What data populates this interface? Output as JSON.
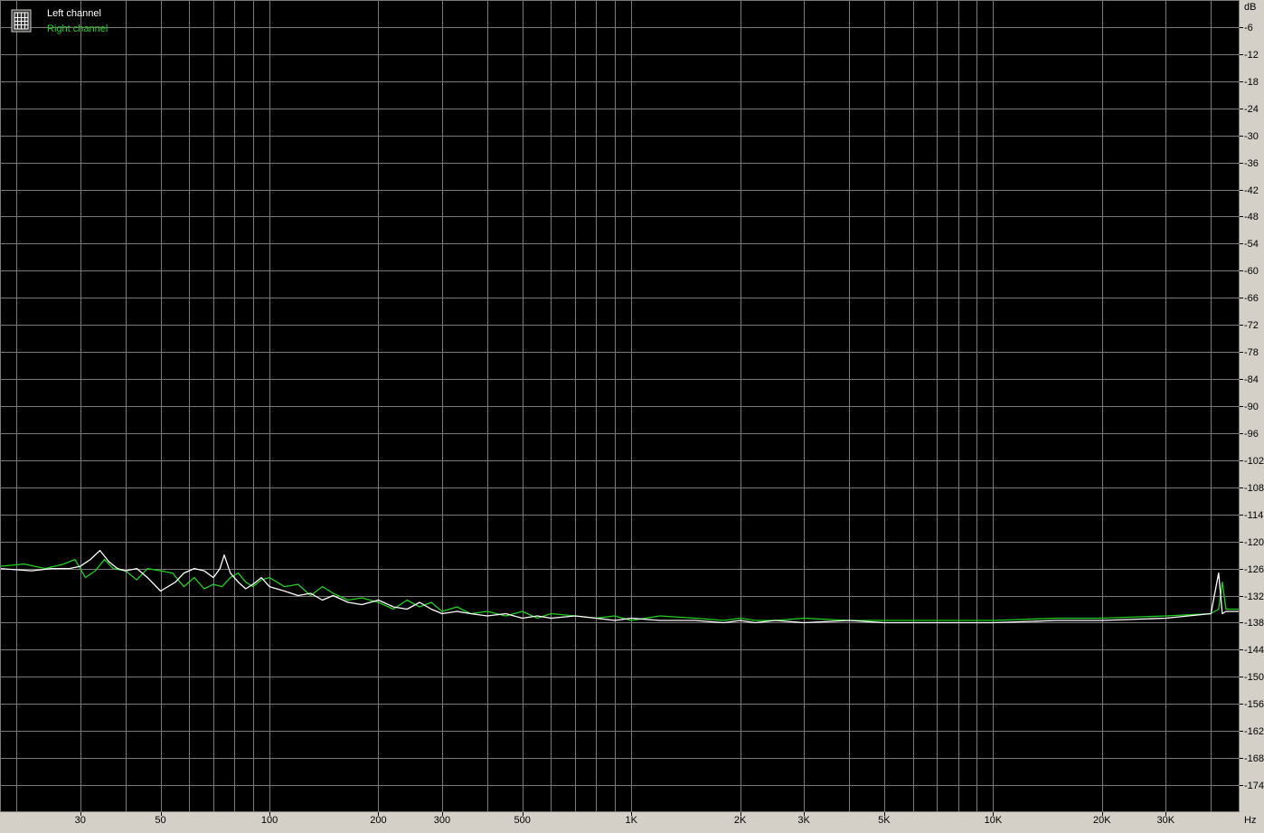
{
  "chart_data": {
    "type": "line",
    "title": "",
    "xlabel": "",
    "ylabel": "",
    "x_scale": "log",
    "x_unit": "Hz",
    "y_unit": "dB",
    "xlim": [
      18,
      48000
    ],
    "ylim": [
      -180,
      0
    ],
    "grid": true,
    "legend_position": "top-left",
    "legend_icon": "grid-chart-icon",
    "x_ticks": [
      {
        "value": 30,
        "label": "30"
      },
      {
        "value": 50,
        "label": "50"
      },
      {
        "value": 100,
        "label": "100"
      },
      {
        "value": 200,
        "label": "200"
      },
      {
        "value": 300,
        "label": "300"
      },
      {
        "value": 500,
        "label": "500"
      },
      {
        "value": 1000,
        "label": "1K"
      },
      {
        "value": 2000,
        "label": "2K"
      },
      {
        "value": 3000,
        "label": "3K"
      },
      {
        "value": 5000,
        "label": "5K"
      },
      {
        "value": 10000,
        "label": "10K"
      },
      {
        "value": 20000,
        "label": "20K"
      },
      {
        "value": 30000,
        "label": "30K"
      }
    ],
    "x_minor_grid": [
      20,
      40,
      60,
      70,
      80,
      90,
      400,
      600,
      700,
      800,
      900,
      4000,
      6000,
      7000,
      8000,
      9000,
      40000
    ],
    "y_ticks": [
      -6,
      -12,
      -18,
      -24,
      -30,
      -36,
      -42,
      -48,
      -54,
      -60,
      -66,
      -72,
      -78,
      -84,
      -90,
      -96,
      -102,
      -108,
      -114,
      -120,
      -126,
      -132,
      -138,
      -144,
      -150,
      -156,
      -162,
      -168,
      -174
    ],
    "colors": {
      "background": "#000000",
      "grid": "#7a7a7a",
      "frame": "#d4d0c8",
      "left": "#ffffff",
      "right": "#1fd11f",
      "text": "#000000"
    },
    "series": [
      {
        "name": "Left channel",
        "color": "#ffffff",
        "x": [
          18,
          22,
          25,
          28,
          30,
          32,
          34,
          36,
          38,
          40,
          43,
          46,
          50,
          55,
          58,
          62,
          66,
          70,
          73,
          75,
          78,
          82,
          86,
          90,
          95,
          100,
          110,
          120,
          130,
          140,
          150,
          165,
          180,
          200,
          220,
          240,
          260,
          280,
          300,
          330,
          360,
          400,
          450,
          500,
          550,
          600,
          700,
          800,
          900,
          1000,
          1200,
          1500,
          1800,
          2000,
          2200,
          2500,
          3000,
          4000,
          5000,
          7000,
          10000,
          15000,
          20000,
          30000,
          40000,
          42000,
          43000,
          44000,
          48000
        ],
        "y": [
          -126,
          -126.5,
          -126,
          -126,
          -125.5,
          -124,
          -122,
          -124.5,
          -126,
          -126.5,
          -126,
          -128,
          -131,
          -129,
          -127,
          -126,
          -126.5,
          -128,
          -126,
          -123,
          -127,
          -129,
          -130.5,
          -129.5,
          -128,
          -130,
          -131,
          -132,
          -131.5,
          -133,
          -132,
          -133.5,
          -134,
          -133,
          -134.5,
          -135,
          -133.5,
          -135,
          -136,
          -135.5,
          -136,
          -136.5,
          -136,
          -137,
          -136.5,
          -137,
          -136.5,
          -137,
          -137.5,
          -137,
          -137.5,
          -137.5,
          -138,
          -137.5,
          -138,
          -137.5,
          -138,
          -137.5,
          -138,
          -138,
          -138,
          -137.5,
          -137.5,
          -137,
          -136,
          -127,
          -136,
          -135.5,
          -135.5
        ]
      },
      {
        "name": "Right channel",
        "color": "#1fd11f",
        "x": [
          18,
          21,
          24,
          27,
          29,
          31,
          33,
          35,
          37,
          40,
          43,
          46,
          50,
          54,
          58,
          62,
          66,
          70,
          74,
          78,
          82,
          86,
          90,
          95,
          100,
          110,
          120,
          130,
          140,
          150,
          165,
          180,
          200,
          220,
          240,
          260,
          280,
          300,
          330,
          360,
          400,
          450,
          500,
          550,
          600,
          700,
          800,
          900,
          1000,
          1200,
          1500,
          1800,
          2000,
          2200,
          2500,
          3000,
          4000,
          5000,
          7000,
          10000,
          15000,
          20000,
          30000,
          40000,
          42000,
          43000,
          44000,
          48000
        ],
        "y": [
          -125.5,
          -125,
          -126,
          -125,
          -124,
          -128,
          -126.5,
          -124,
          -126,
          -126.5,
          -128.5,
          -126,
          -126.5,
          -127,
          -130,
          -128,
          -130.5,
          -129.5,
          -130,
          -128,
          -127,
          -129,
          -130,
          -128.5,
          -128,
          -130,
          -129.5,
          -132,
          -130,
          -131.5,
          -133,
          -132.5,
          -133.5,
          -135,
          -133,
          -134.5,
          -133.5,
          -135.5,
          -134.5,
          -136,
          -135.5,
          -136.5,
          -135.5,
          -137,
          -136,
          -136.5,
          -137,
          -136.5,
          -137.5,
          -136.5,
          -137,
          -137.5,
          -137,
          -137.5,
          -137.5,
          -137,
          -137.5,
          -137.5,
          -137.5,
          -137.5,
          -137,
          -137,
          -136.5,
          -136,
          -135,
          -129,
          -135,
          -135
        ]
      }
    ]
  }
}
